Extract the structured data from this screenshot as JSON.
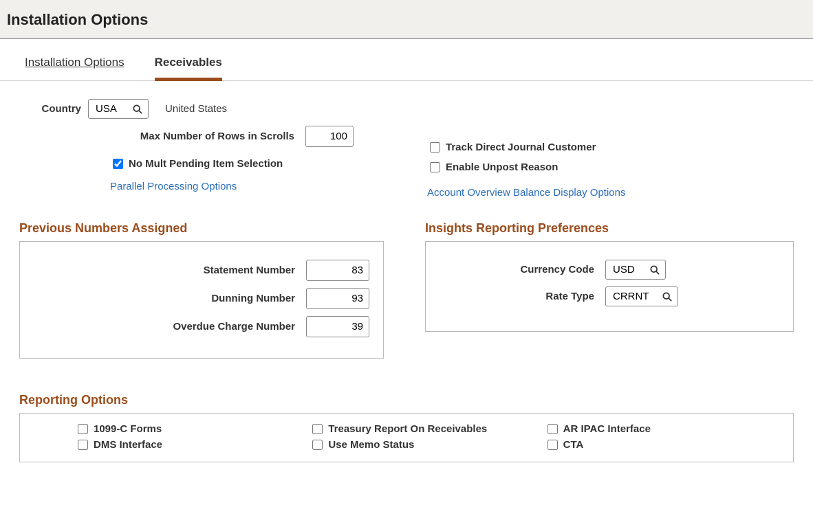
{
  "header": {
    "title": "Installation Options"
  },
  "tabs": {
    "installation_options": "Installation Options",
    "receivables": "Receivables"
  },
  "country": {
    "label": "Country",
    "value": "USA",
    "description": "United States"
  },
  "max_rows": {
    "label": "Max Number of Rows in Scrolls",
    "value": "100"
  },
  "no_mult_pending": {
    "label": "No Mult Pending Item Selection",
    "checked": true
  },
  "parallel_link": "Parallel Processing Options",
  "track_direct": {
    "label": "Track Direct Journal Customer",
    "checked": false
  },
  "enable_unpost": {
    "label": "Enable Unpost Reason",
    "checked": false
  },
  "balance_link": "Account Overview Balance Display Options",
  "sections": {
    "previous": "Previous Numbers Assigned",
    "insights": "Insights Reporting Preferences",
    "reporting": "Reporting Options"
  },
  "previous": {
    "statement": {
      "label": "Statement Number",
      "value": "83"
    },
    "dunning": {
      "label": "Dunning Number",
      "value": "93"
    },
    "overdue": {
      "label": "Overdue Charge Number",
      "value": "39"
    }
  },
  "insights": {
    "currency": {
      "label": "Currency Code",
      "value": "USD"
    },
    "rate_type": {
      "label": "Rate Type",
      "value": "CRRNT"
    }
  },
  "reporting": {
    "c1099": "1099-C Forms",
    "dms": "DMS Interface",
    "treasury": "Treasury Report On Receivables",
    "memo": "Use Memo Status",
    "ipac": "AR IPAC Interface",
    "cta": "CTA"
  }
}
